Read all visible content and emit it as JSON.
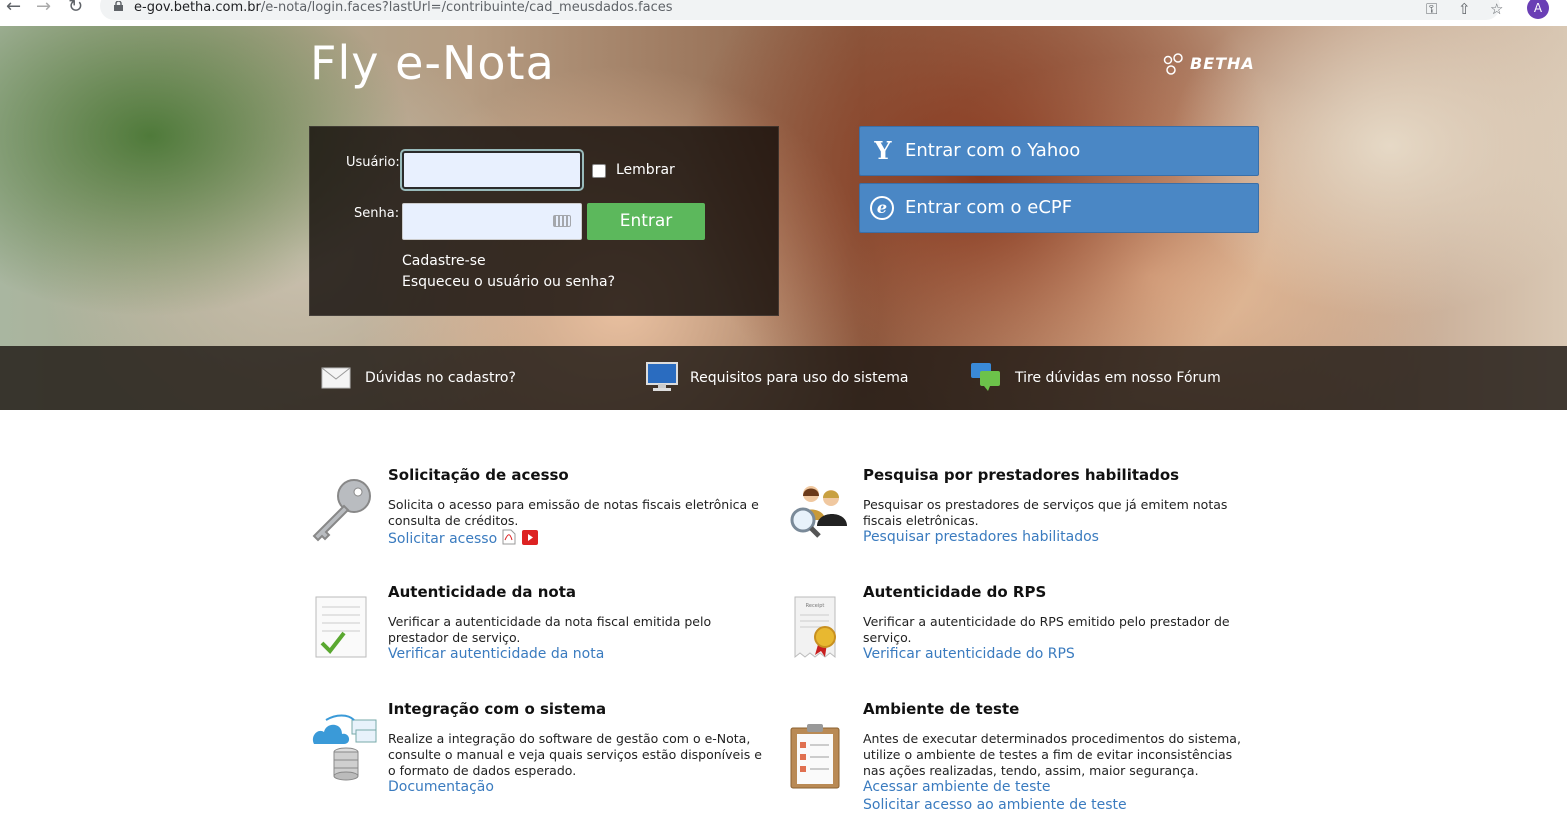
{
  "browser": {
    "url_host": "e-gov.betha.com.br",
    "url_path": "/e-nota/login.faces?lastUrl=/contribuinte/cad_meusdados.faces",
    "avatar_letter": "A"
  },
  "header": {
    "title": "Fly e-Nota",
    "brand": "BETHA"
  },
  "login": {
    "user_label": "Usuário:",
    "password_label": "Senha:",
    "remember_label": "Lembrar",
    "enter_label": "Entrar",
    "signup_link": "Cadastre-se",
    "forgot_link": "Esqueceu o usuário ou senha?"
  },
  "sso": {
    "yahoo_label": "Entrar com o Yahoo",
    "ecpf_label": "Entrar com o eCPF"
  },
  "helpbar": {
    "items": [
      {
        "label": "Dúvidas no cadastro?",
        "icon": "envelope-icon"
      },
      {
        "label": "Requisitos para uso do sistema",
        "icon": "monitor-icon"
      },
      {
        "label": "Tire dúvidas em nosso Fórum",
        "icon": "chat-bubbles-icon"
      }
    ]
  },
  "cards": {
    "access": {
      "title": "Solicitação de acesso",
      "desc": "Solicita o acesso para emissão de notas fiscais eletrônica e consulta de créditos.",
      "link": "Solicitar acesso",
      "icon": "key-icon"
    },
    "providers": {
      "title": "Pesquisa por prestadores habilitados",
      "desc": "Pesquisar os prestadores de serviços que já emitem notas fiscais eletrônicas.",
      "link": "Pesquisar prestadores habilitados",
      "icon": "people-search-icon"
    },
    "note_auth": {
      "title": "Autenticidade da nota",
      "desc": "Verificar a autenticidade da nota fiscal emitida pelo prestador de serviço.",
      "link": "Verificar autenticidade da nota",
      "icon": "document-check-icon"
    },
    "rps_auth": {
      "title": "Autenticidade do RPS",
      "desc": "Verificar a autenticidade do RPS emitido pelo prestador de serviço.",
      "link": "Verificar autenticidade do RPS",
      "icon": "receipt-seal-icon",
      "receipt_label": "Receipt"
    },
    "integration": {
      "title": "Integração com o sistema",
      "desc": "Realize a integração do software de gestão com o e-Nota, consulte o manual e veja quais serviços estão disponíveis e o formato de dados esperado.",
      "link": "Documentação",
      "icon": "cloud-database-icon"
    },
    "test_env": {
      "title": "Ambiente de teste",
      "desc": "Antes de executar determinados procedimentos do sistema, utilize o ambiente de testes a fim de evitar inconsistências nas ações realizadas, tendo, assim, maior segurança.",
      "link1": "Acessar ambiente de teste",
      "link2": "Solicitar acesso ao ambiente de teste",
      "icon": "clipboard-icon"
    }
  },
  "colors": {
    "link": "#3a7bbf",
    "sso_blue": "#4a87c5",
    "enter_green": "#5cb85c"
  }
}
